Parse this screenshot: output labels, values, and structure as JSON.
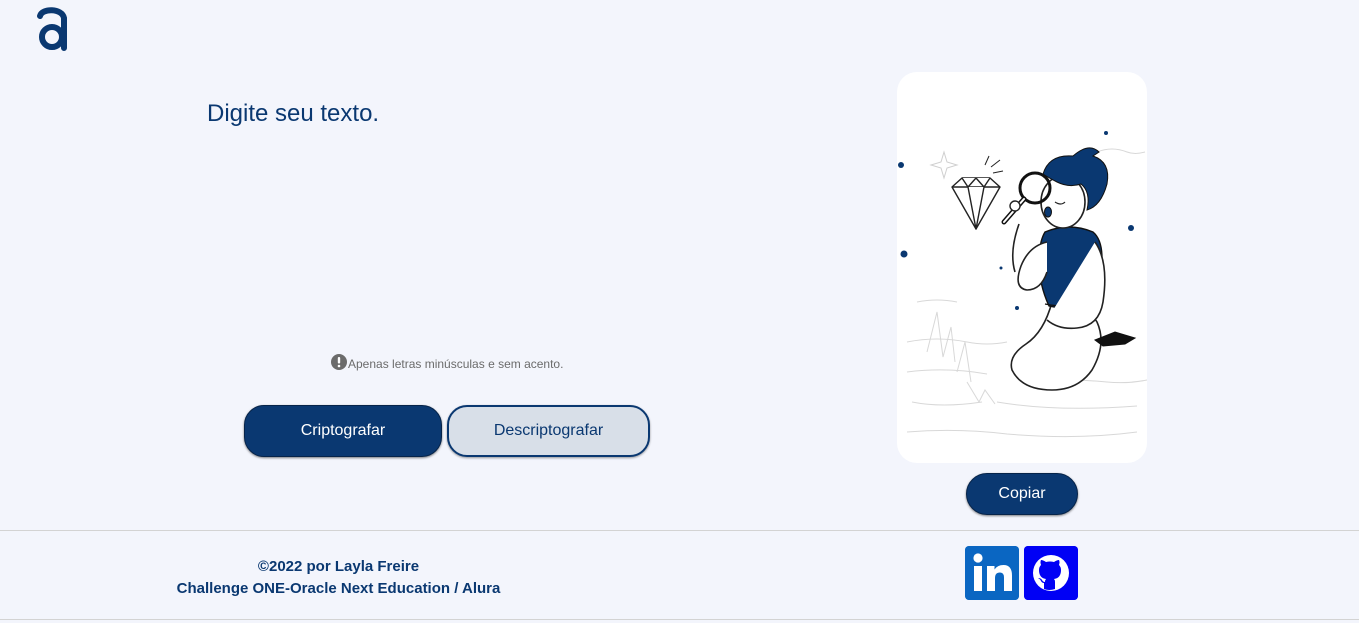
{
  "logo": {
    "icon": "alura-logo-icon",
    "color": "#0a3871"
  },
  "input": {
    "placeholder": "Digite seu texto.",
    "value": ""
  },
  "hint": {
    "icon": "exclamation-circle-icon",
    "text": "Apenas letras minúsculas e sem acento."
  },
  "buttons": {
    "encrypt_label": "Criptografar",
    "decrypt_label": "Descriptografar",
    "copy_label": "Copiar"
  },
  "output": {
    "illustration": "person-with-magnifying-glass-and-diamond-illustration"
  },
  "footer": {
    "credit_line": "©2022 por Layla Freire",
    "challenge_line": "Challenge ONE-Oracle Next Education / Alura",
    "social": [
      {
        "name": "linkedin-icon",
        "color": "#0a66c2"
      },
      {
        "name": "github-icon",
        "color": "#0000f5"
      }
    ]
  },
  "colors": {
    "primary": "#0a3871",
    "background": "#f3f5fc",
    "secondary_button": "#d8dfe8"
  }
}
